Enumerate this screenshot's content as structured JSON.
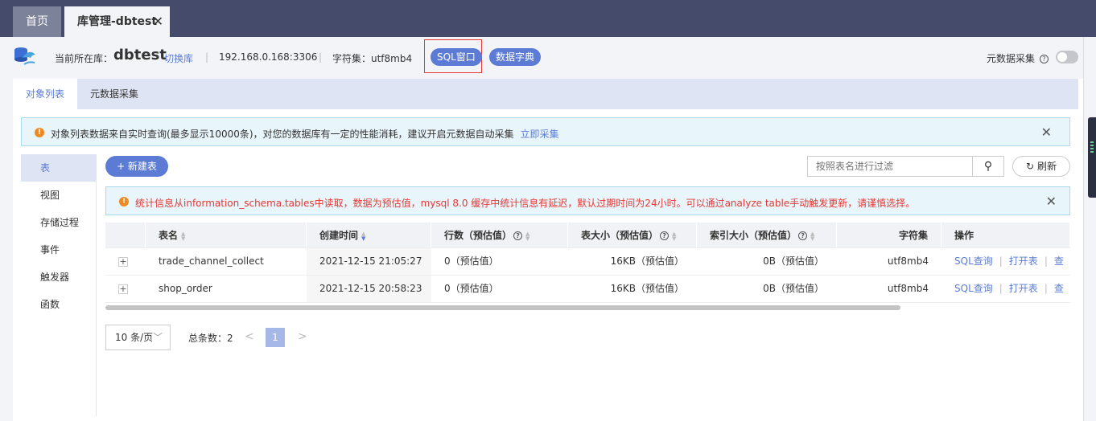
{
  "tabs": [
    {
      "label": "首页"
    },
    {
      "label": "库管理-dbtest"
    }
  ],
  "info": {
    "current_db_label": "当前所在库：",
    "db_name": "dbtest",
    "switch_label": "切换库",
    "ip": "192.168.0.168:3306",
    "charset": "字符集：utf8mb4",
    "sql_window": "SQL窗口",
    "data_dict": "数据字典",
    "meta_collect": "元数据采集"
  },
  "subtabs": [
    {
      "label": "对象列表"
    },
    {
      "label": "元数据采集"
    }
  ],
  "notice": {
    "text": "对象列表数据来自实时查询(最多显示10000条)，对您的数据库有一定的性能消耗，建议开启元数据自动采集",
    "link": "立即采集"
  },
  "sidebar": {
    "items": [
      {
        "label": "表"
      },
      {
        "label": "视图"
      },
      {
        "label": "存储过程"
      },
      {
        "label": "事件"
      },
      {
        "label": "触发器"
      },
      {
        "label": "函数"
      }
    ]
  },
  "toolbar": {
    "new_table": "+ 新建表",
    "filter_placeholder": "按照表名进行过滤",
    "refresh": "刷新"
  },
  "stat_notice": {
    "text": "统计信息从information_schema.tables中读取，数据为预估值，mysql 8.0 缓存中统计信息有延迟，默认过期时间为24小时。可以通过analyze table手动触发更新，请谨慎选择。"
  },
  "table": {
    "columns": [
      "表名",
      "创建时间",
      "行数（预估值）",
      "表大小（预估值）",
      "索引大小（预估值）",
      "字符集",
      "操作"
    ],
    "rows": [
      {
        "name": "trade_channel_collect",
        "created": "2021-12-15 21:05:27",
        "rows": "0（预估值）",
        "size": "16KB（预估值）",
        "index_size": "0B（预估值）",
        "charset": "utf8mb4"
      },
      {
        "name": "shop_order",
        "created": "2021-12-15 20:58:23",
        "rows": "0（预估值）",
        "size": "16KB（预估值）",
        "index_size": "0B（预估值）",
        "charset": "utf8mb4"
      }
    ],
    "ops": {
      "sql_query": "SQL查询",
      "open_table": "打开表",
      "view": "查"
    }
  },
  "pager": {
    "page_size": "10 条/页",
    "total": "总条数：2",
    "current_page": "1"
  },
  "colors": {
    "accent": "#5b7bd5",
    "topbar": "#454c6b",
    "warning": "#f0891f",
    "error_text": "#e53935"
  }
}
